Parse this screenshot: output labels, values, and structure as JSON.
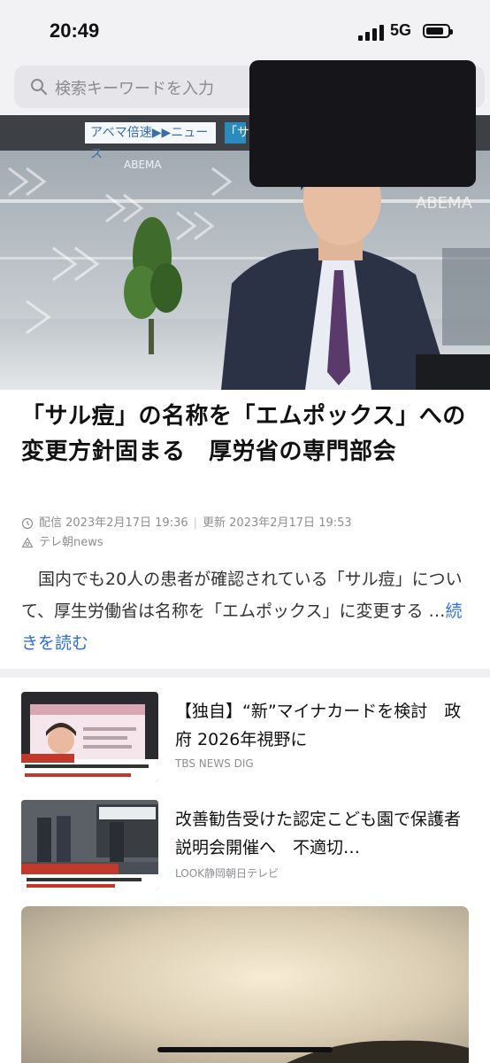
{
  "status_bar": {
    "time": "20:49",
    "network": "5G"
  },
  "search": {
    "placeholder": "検索キーワードを入力"
  },
  "hero": {
    "banner_text": "アベマ倍速▶▶ニュース",
    "tag_text": "「サ"
  },
  "article": {
    "headline": "「サル痘」の名称を「エムポックス」への変更方針固まる　厚労省の専門部会",
    "published": "配信 2023年2月17日 19:36",
    "updated": "更新 2023年2月17日 19:53",
    "source": "テレ朝news",
    "summary": "国内でも20人の患者が確認されている「サル痘」について、厚生労働省は名称を「エムポックス」に変更する …",
    "read_more": "続きを読む"
  },
  "related": [
    {
      "title": "【独自】“新”マイナカードを検討　政府 2026年視野に",
      "source": "TBS NEWS DIG"
    },
    {
      "title": "改善勧告受けた認定こども園で保護者説明会開催へ　不適切…",
      "source": "LOOK静岡朝日テレビ"
    }
  ],
  "colors": {
    "link": "#2f6fd6",
    "background": "#ffffff",
    "status_bg": "#f2f2f4"
  },
  "icons": [
    "search-icon",
    "clock-icon",
    "source-icon",
    "signal-icon",
    "battery-icon"
  ]
}
